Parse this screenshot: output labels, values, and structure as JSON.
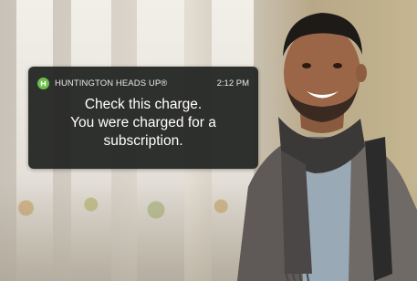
{
  "notification": {
    "app_name": "HUNTINGTON HEADS UP®",
    "time": "2:12 PM",
    "app_icon": "huntington-logo-icon",
    "message_lines": [
      "Check this charge.",
      "You were charged for a",
      "subscription."
    ],
    "colors": {
      "background": "#222422",
      "app_icon": "#6cc04a",
      "text": "#ffffff"
    }
  },
  "photo": {
    "subject": "smiling-man-with-scarf-and-backpack"
  }
}
